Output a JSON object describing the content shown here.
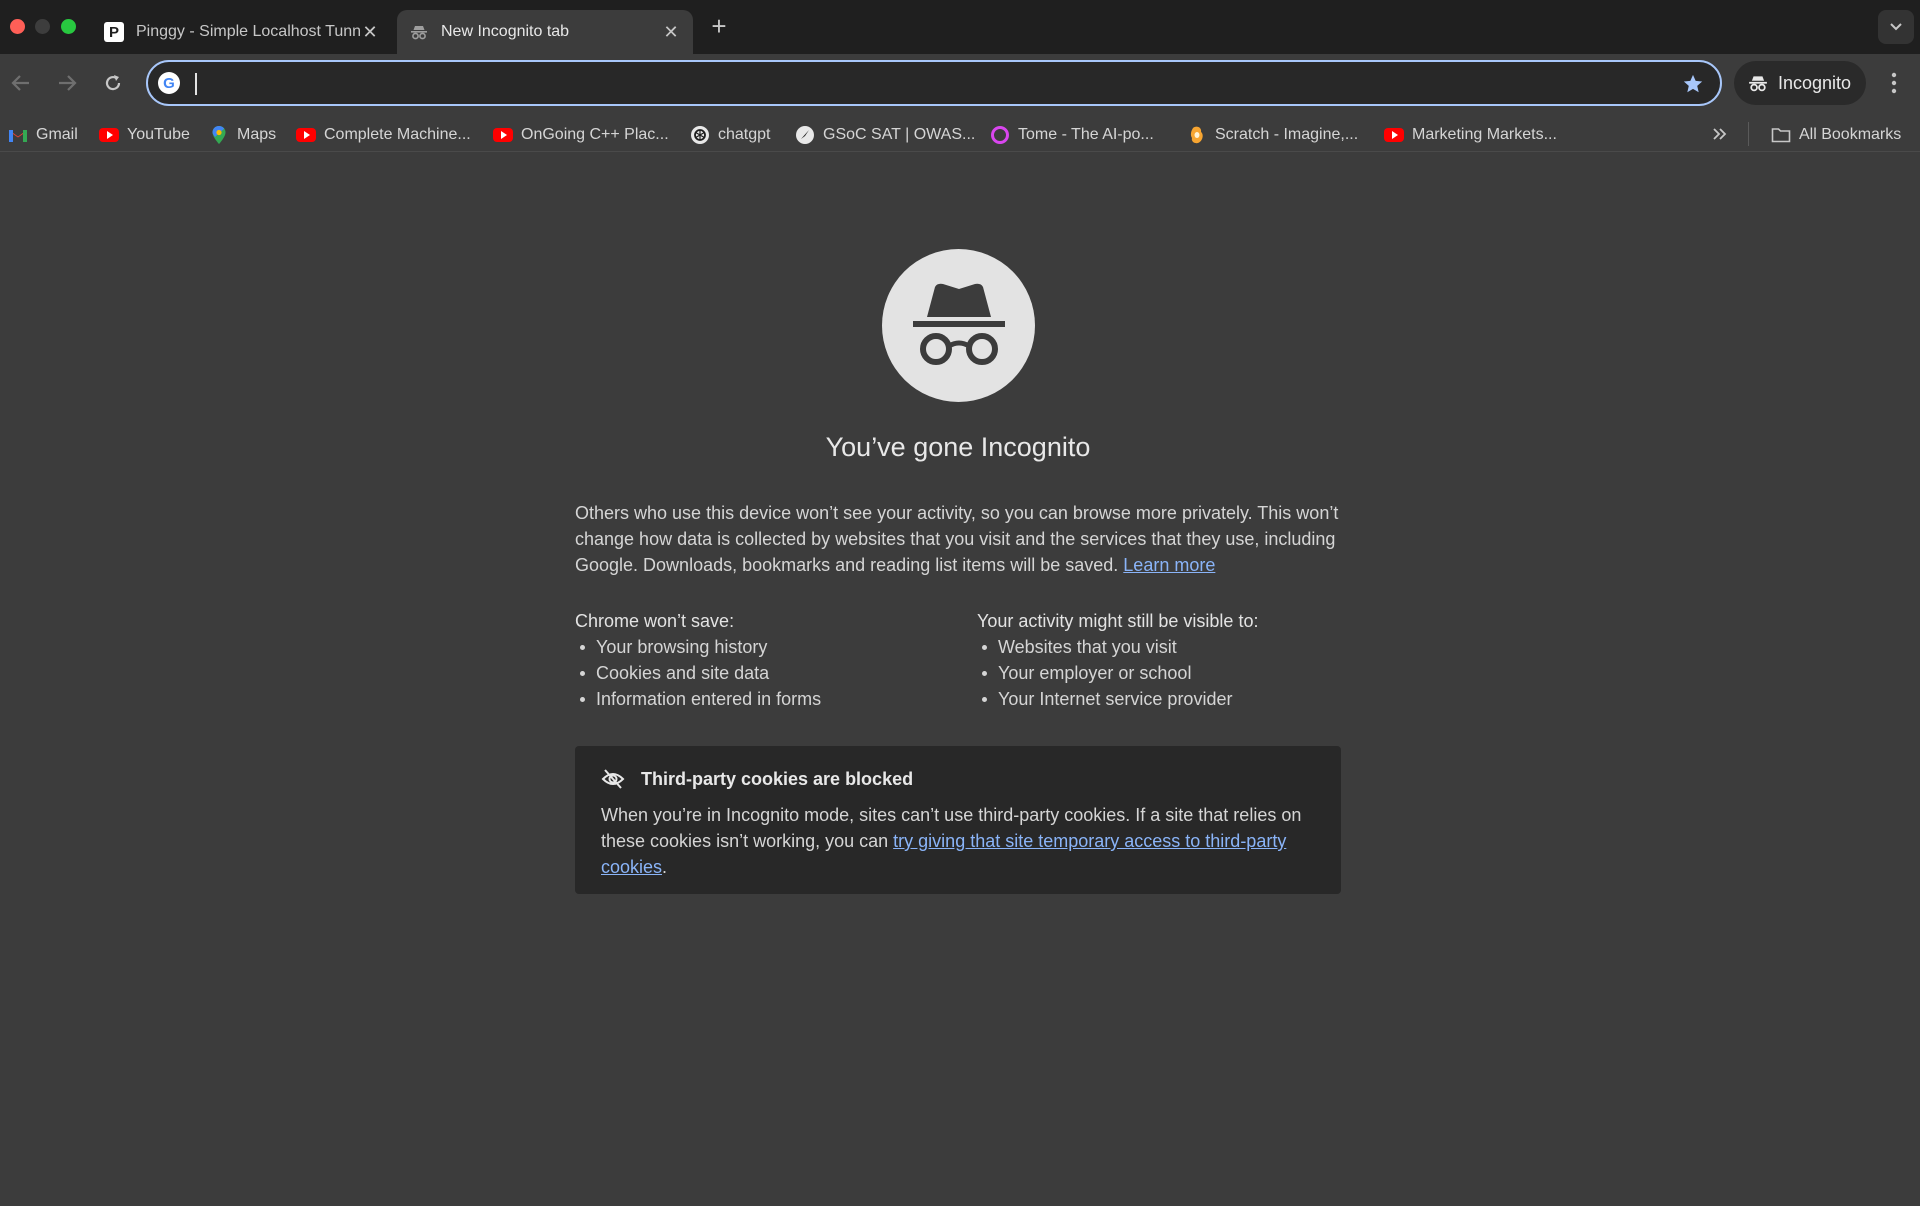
{
  "tabs": [
    {
      "title": "Pinggy - Simple Localhost Tunnels",
      "favicon": "P"
    },
    {
      "title": "New Incognito tab"
    }
  ],
  "omnibox": {
    "value": "",
    "placeholder": ""
  },
  "profile": {
    "label": "Incognito"
  },
  "bookmarks": [
    {
      "label": "Gmail",
      "icon": "gmail-icon"
    },
    {
      "label": "YouTube",
      "icon": "youtube-icon"
    },
    {
      "label": "Maps",
      "icon": "maps-icon"
    },
    {
      "label": "Complete Machine...",
      "icon": "youtube-icon"
    },
    {
      "label": "OnGoing C++ Plac...",
      "icon": "youtube-icon"
    },
    {
      "label": "chatgpt",
      "icon": "chatgpt-icon"
    },
    {
      "label": "GSoC SAT | OWAS...",
      "icon": "owasp-icon"
    },
    {
      "label": "Tome - The AI-po...",
      "icon": "tome-icon"
    },
    {
      "label": "Scratch - Imagine,...",
      "icon": "scratch-icon"
    },
    {
      "label": "Marketing Markets...",
      "icon": "youtube-icon"
    }
  ],
  "all_bookmarks": "All Bookmarks",
  "main": {
    "headline": "You’ve gone Incognito",
    "para_text": "Others who use this device won’t see your activity, so you can browse more privately. This won’t change how data is collected by websites that you visit and the services that they use, including Google. Downloads, bookmarks and reading list items will be saved.",
    "learn_more": "Learn more",
    "left_heading": "Chrome won’t save:",
    "left_items": [
      "Your browsing history",
      "Cookies and site data",
      "Information entered in forms"
    ],
    "right_heading": "Your activity might still be visible to:",
    "right_items": [
      "Websites that you visit",
      "Your employer or school",
      "Your Internet service provider"
    ],
    "cookie_title": "Third-party cookies are blocked",
    "cookie_text": "When you’re in Incognito mode, sites can’t use third-party cookies. If a site that relies on these cookies isn’t working, you can",
    "cookie_link": "try giving that site temporary access to third-party cookies",
    "cookie_end": "."
  }
}
